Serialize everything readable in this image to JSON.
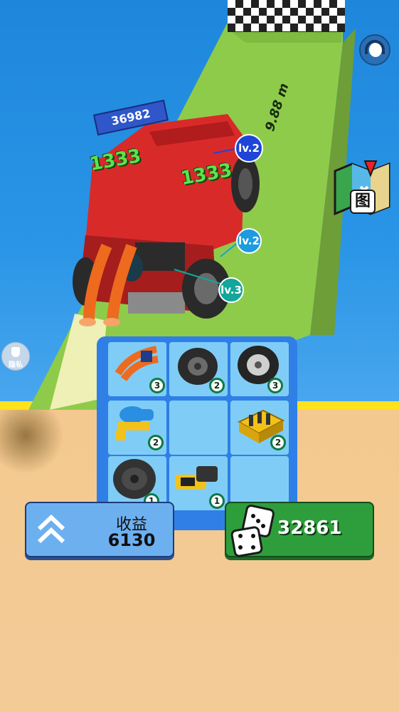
{
  "hud": {
    "support_icon": "headset-support-icon",
    "map_icon": "folded-map-icon",
    "map_label": "图",
    "privacy_label": "隐私",
    "privacy_icon": "shield-icon"
  },
  "race": {
    "score_banner": "36982",
    "float_values": [
      "1333",
      "1333"
    ],
    "distance": "9.88 m",
    "part_levels": [
      "lv.2",
      "lv.2",
      "lv.3"
    ]
  },
  "merge_grid": {
    "rows": 3,
    "cols": 3,
    "cells": [
      {
        "item": "jet-exhaust-icon",
        "level": "3"
      },
      {
        "item": "tire-icon",
        "level": "2"
      },
      {
        "item": "alloy-wheel-icon",
        "level": "3"
      },
      {
        "item": "fuel-tank-icon",
        "level": "2"
      },
      {
        "item": "",
        "level": ""
      },
      {
        "item": "engine-block-icon",
        "level": "2"
      },
      {
        "item": "tire-icon",
        "level": "1"
      },
      {
        "item": "spray-nozzle-icon",
        "level": "1"
      },
      {
        "item": "",
        "level": ""
      }
    ]
  },
  "buttons": {
    "income_title": "收益",
    "income_value": "6130",
    "income_icon": "double-chevron-up-icon",
    "dice_value": "32861",
    "dice_icon": "dice-icon"
  },
  "colors": {
    "car": "#d92a2a",
    "grass": "#8fcb4a",
    "board": "#2f7fe6",
    "income_button": "#6db0f0",
    "dice_button": "#2e9e3c",
    "level_badge": "#0e7a44"
  }
}
